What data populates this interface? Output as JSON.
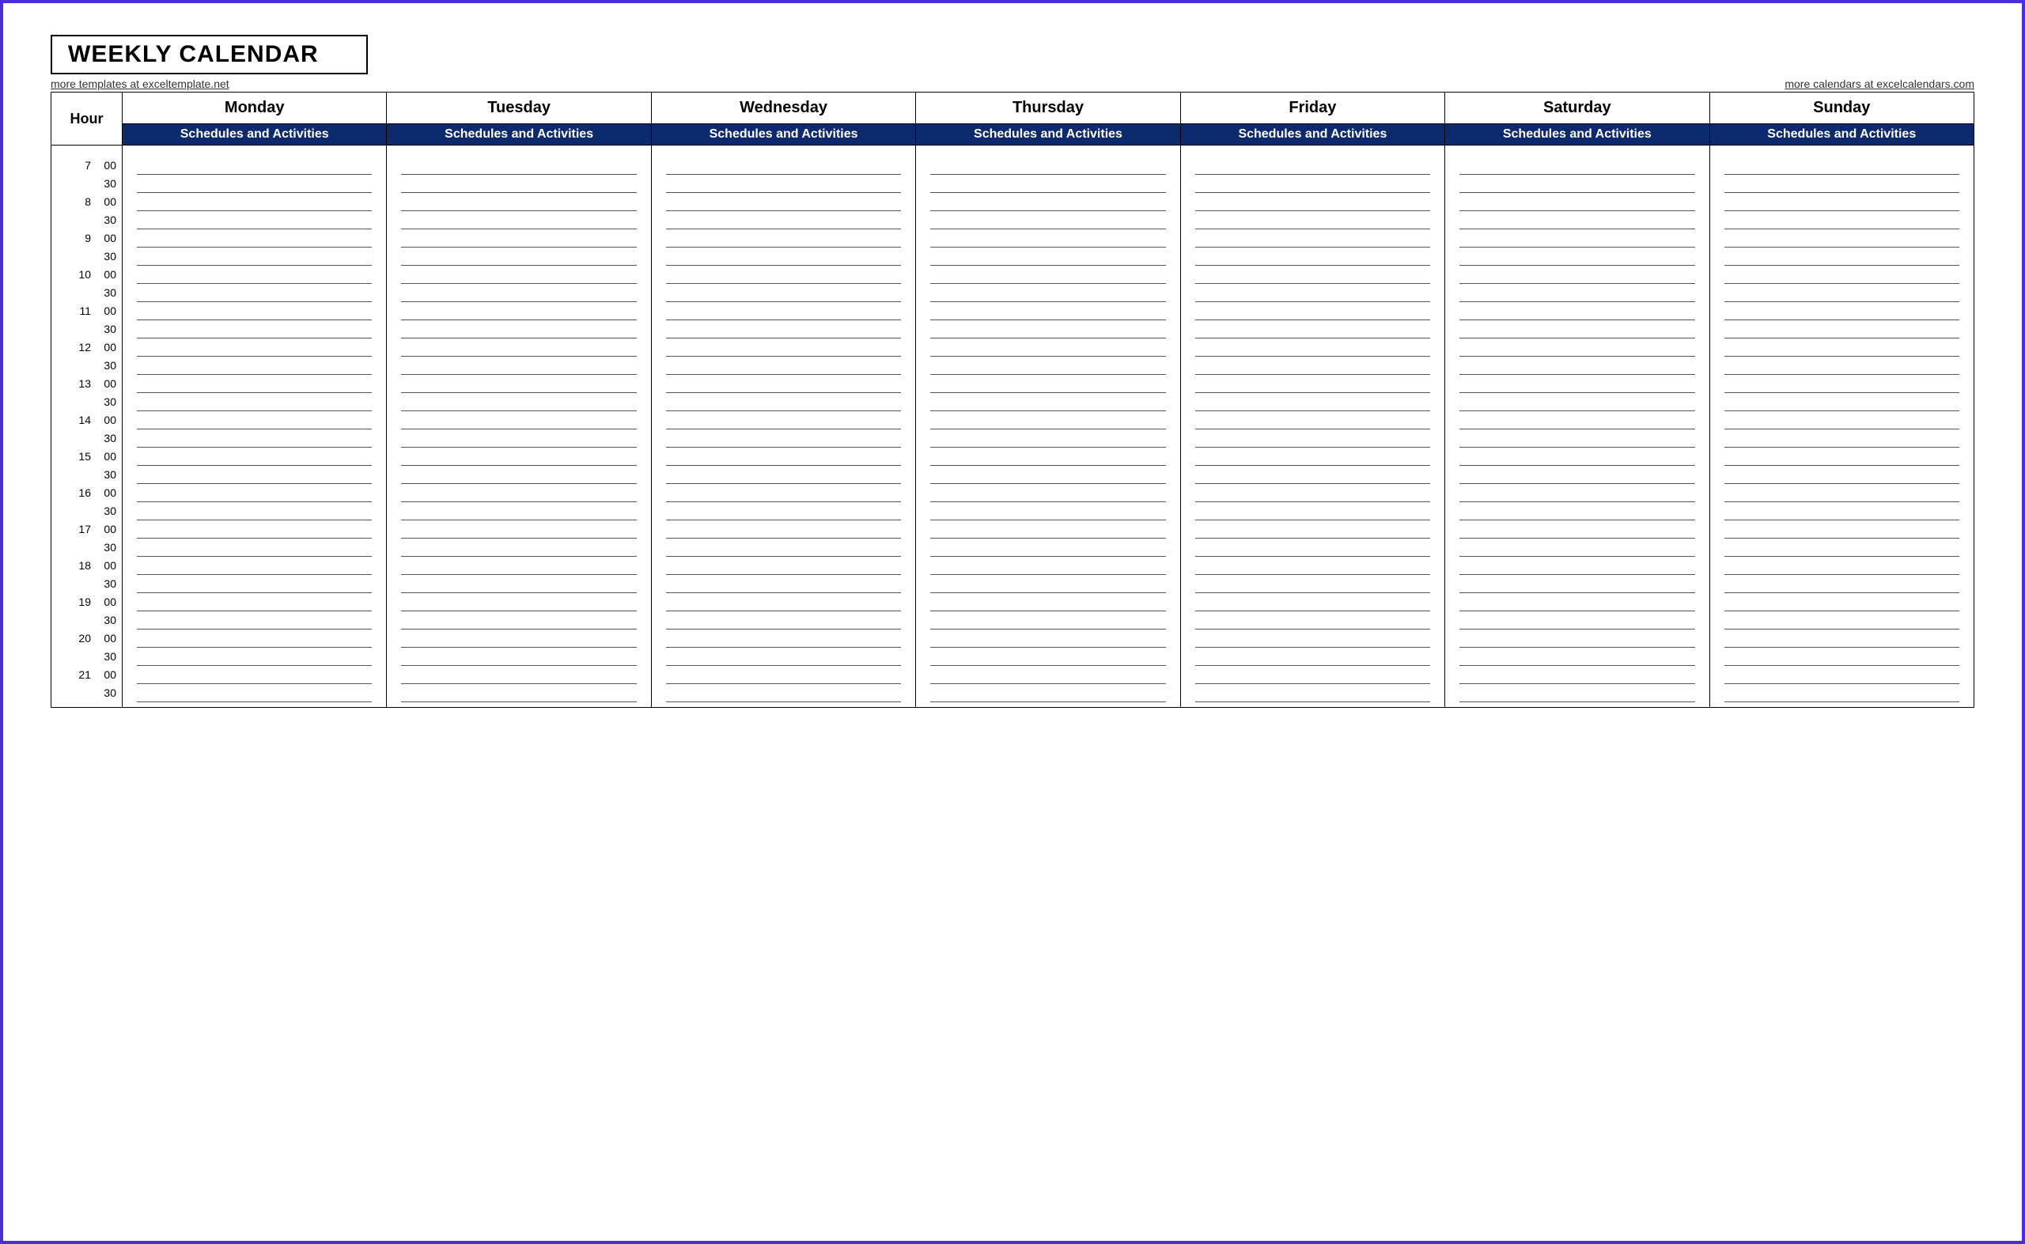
{
  "title": "WEEKLY CALENDAR",
  "links": {
    "left": "more templates at exceltemplate.net",
    "right": "more calendars at excelcalendars.com"
  },
  "header": {
    "hour_label": "Hour",
    "days": [
      "Monday",
      "Tuesday",
      "Wednesday",
      "Thursday",
      "Friday",
      "Saturday",
      "Sunday"
    ],
    "sub_header": "Schedules and Activities"
  },
  "time_slots": [
    {
      "hour": "7",
      "min": "00"
    },
    {
      "hour": "",
      "min": "30"
    },
    {
      "hour": "8",
      "min": "00"
    },
    {
      "hour": "",
      "min": "30"
    },
    {
      "hour": "9",
      "min": "00"
    },
    {
      "hour": "",
      "min": "30"
    },
    {
      "hour": "10",
      "min": "00"
    },
    {
      "hour": "",
      "min": "30"
    },
    {
      "hour": "11",
      "min": "00"
    },
    {
      "hour": "",
      "min": "30"
    },
    {
      "hour": "12",
      "min": "00"
    },
    {
      "hour": "",
      "min": "30"
    },
    {
      "hour": "13",
      "min": "00"
    },
    {
      "hour": "",
      "min": "30"
    },
    {
      "hour": "14",
      "min": "00"
    },
    {
      "hour": "",
      "min": "30"
    },
    {
      "hour": "15",
      "min": "00"
    },
    {
      "hour": "",
      "min": "30"
    },
    {
      "hour": "16",
      "min": "00"
    },
    {
      "hour": "",
      "min": "30"
    },
    {
      "hour": "17",
      "min": "00"
    },
    {
      "hour": "",
      "min": "30"
    },
    {
      "hour": "18",
      "min": "00"
    },
    {
      "hour": "",
      "min": "30"
    },
    {
      "hour": "19",
      "min": "00"
    },
    {
      "hour": "",
      "min": "30"
    },
    {
      "hour": "20",
      "min": "00"
    },
    {
      "hour": "",
      "min": "30"
    },
    {
      "hour": "21",
      "min": "00"
    },
    {
      "hour": "",
      "min": "30"
    }
  ]
}
